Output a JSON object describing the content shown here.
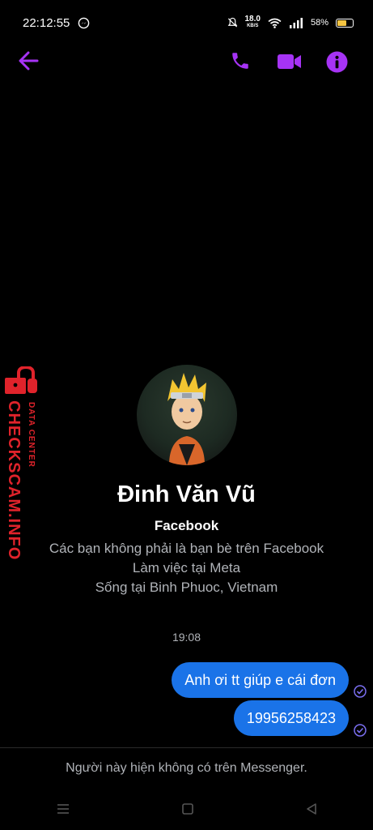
{
  "status": {
    "time": "22:12:55",
    "speed_value": "18.0",
    "speed_unit": "KB/S",
    "battery": "58%"
  },
  "contact": {
    "name": "Đinh Văn Vũ",
    "platform": "Facebook",
    "lines": [
      "Các bạn không phải là bạn bè trên Facebook",
      "Làm việc tại Meta",
      "Sống tại Binh Phuoc, Vietnam"
    ]
  },
  "chat": {
    "timestamp": "19:08",
    "messages": [
      {
        "text": "Anh ơi tt giúp e cái đơn"
      },
      {
        "text": "19956258423"
      }
    ]
  },
  "notice": "Người này hiện không có trên Messenger.",
  "watermark": {
    "main": "CHECKSCAM.INFO",
    "sub": "DATA CENTER"
  },
  "colors": {
    "accent": "#a633f5",
    "bubble": "#1a73e8",
    "watermark": "#e0232b"
  }
}
